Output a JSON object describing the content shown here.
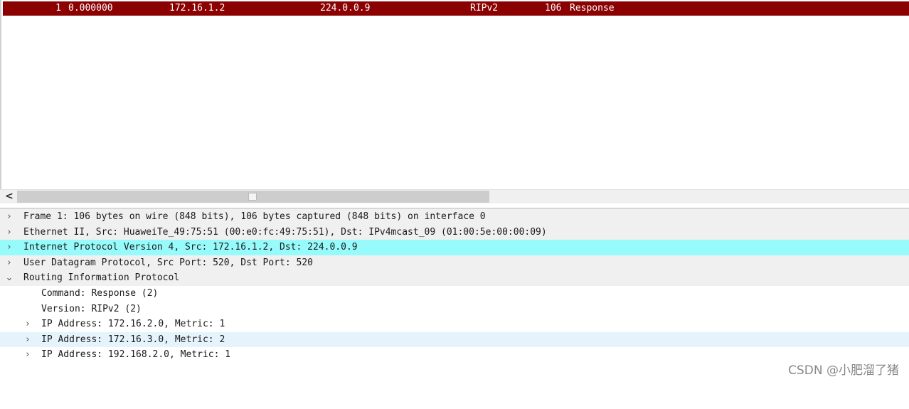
{
  "packet_list": {
    "rows": [
      {
        "no": "1",
        "time": "0.000000",
        "source": "172.16.1.2",
        "destination": "224.0.0.9",
        "protocol": "RIPv2",
        "length": "106",
        "info": "Response"
      }
    ],
    "row_color": "#8b0000"
  },
  "scrollbar": {
    "left_arrow_icon": "chevron-left-icon",
    "left_arrow_glyph": "<"
  },
  "details": {
    "expand_glyph": "›",
    "collapse_glyph": "⌄",
    "rows": [
      {
        "text": "Frame 1: 106 bytes on wire (848 bits), 106 bytes captured (848 bits) on interface 0",
        "state": "collapsed"
      },
      {
        "text": "Ethernet II, Src: HuaweiTe_49:75:51 (00:e0:fc:49:75:51), Dst: IPv4mcast_09 (01:00:5e:00:00:09)",
        "state": "collapsed"
      },
      {
        "text": "Internet Protocol Version 4, Src: 172.16.1.2, Dst: 224.0.0.9",
        "state": "collapsed",
        "selected": true
      },
      {
        "text": "User Datagram Protocol, Src Port: 520, Dst Port: 520",
        "state": "collapsed"
      },
      {
        "text": "Routing Information Protocol",
        "state": "expanded"
      },
      {
        "text": "Command: Response (2)"
      },
      {
        "text": "Version: RIPv2 (2)"
      },
      {
        "text": "IP Address: 172.16.2.0, Metric: 1",
        "state": "collapsed"
      },
      {
        "text": "IP Address: 172.16.3.0, Metric: 2",
        "state": "collapsed"
      },
      {
        "text": "IP Address: 192.168.2.0, Metric: 1",
        "state": "collapsed"
      }
    ],
    "selected_color": "#97fbfc"
  },
  "watermark": "CSDN @小肥溜了猪"
}
